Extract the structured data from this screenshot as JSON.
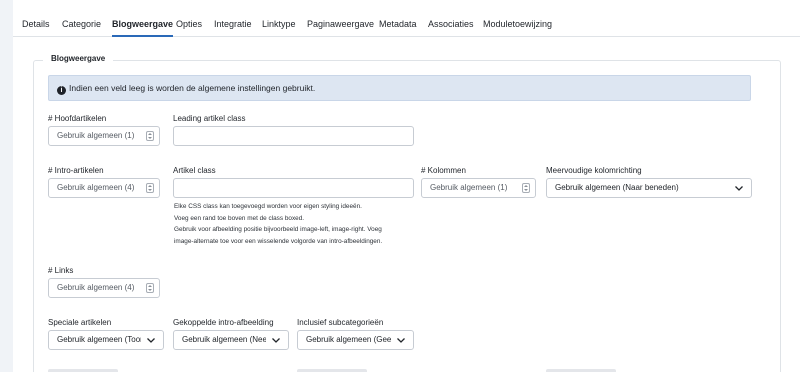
{
  "tabs": [
    {
      "label": "Details",
      "active": false
    },
    {
      "label": "Categorie",
      "active": false
    },
    {
      "label": "Blogweergave",
      "active": true
    },
    {
      "label": "Opties",
      "active": false
    },
    {
      "label": "Integratie",
      "active": false
    },
    {
      "label": "Linktype",
      "active": false
    },
    {
      "label": "Paginaweergave",
      "active": false
    },
    {
      "label": "Metadata",
      "active": false
    },
    {
      "label": "Associaties",
      "active": false
    },
    {
      "label": "Moduletoewijzing",
      "active": false
    }
  ],
  "fieldset": {
    "legend": "Blogweergave",
    "alert": "Indien een veld leeg is worden de algemene instellingen gebruikt."
  },
  "fields": {
    "hoofdartikelen": {
      "label": "# Hoofdartikelen",
      "placeholder": "Gebruik algemeen (1)"
    },
    "leading_class": {
      "label": "Leading artikel class",
      "value": ""
    },
    "intro_artikelen": {
      "label": "# Intro-artikelen",
      "placeholder": "Gebruik algemeen (4)"
    },
    "artikel_class": {
      "label": "Artikel class",
      "value": ""
    },
    "kolommen": {
      "label": "# Kolommen",
      "placeholder": "Gebruik algemeen (1)"
    },
    "kolomrichting": {
      "label": "Meervoudige kolomrichting",
      "value": "Gebruik algemeen (Naar beneden)"
    },
    "links": {
      "label": "# Links",
      "placeholder": "Gebruik algemeen (4)"
    },
    "speciale": {
      "label": "Speciale artikelen",
      "value": "Gebruik algemeen (Toon)"
    },
    "gekoppelde": {
      "label": "Gekoppelde intro-afbeelding",
      "value": "Gebruik algemeen (Nee)"
    },
    "subcategorieen": {
      "label": "Inclusief subcategorieën",
      "value": "Gebruik algemeen (Geen)"
    }
  },
  "help": {
    "artikel_class": [
      "Elke CSS class kan toegevoegd worden voor eigen styling ideeën.",
      "Voeg een rand toe boven met de class boxed.",
      "Gebruik voor afbeelding positie bijvoorbeeld image-left, image-right. Voeg",
      "image-alternate toe voor een wisselende volgorde van intro-afbeeldingen."
    ]
  },
  "colors": {
    "accent": "#2a69b8",
    "alert_bg": "#dde6f2",
    "page_bg": "#f0f3f7"
  },
  "icons": {
    "alert": "info-circle-icon",
    "number": "spinner-icon",
    "select": "chevron-down-icon"
  }
}
